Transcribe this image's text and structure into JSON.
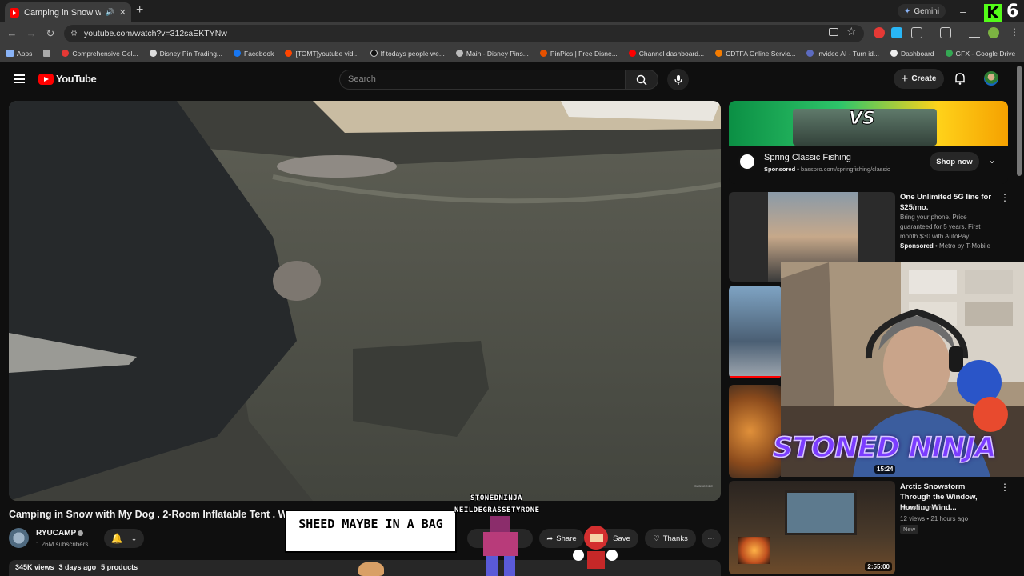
{
  "browser": {
    "tab_title": "Camping in Snow with My Do",
    "new_tab": "+",
    "gemini_label": "Gemini",
    "url": "youtube.com/watch?v=312saEKTYNw",
    "overlay_counter": "6",
    "bookmarks": [
      {
        "label": "Apps",
        "color": "#8ab4f8"
      },
      {
        "label": "Comprehensive Gol...",
        "color": "#e53935"
      },
      {
        "label": "Disney Pin Trading...",
        "color": "#dddddd"
      },
      {
        "label": "Facebook",
        "color": "#1877f2"
      },
      {
        "label": "[TOMT]youtube vid...",
        "color": "#ff4500"
      },
      {
        "label": "If todays people we...",
        "color": "#111111"
      },
      {
        "label": "Main - Disney Pins...",
        "color": "#bbbbbb"
      },
      {
        "label": "PinPics | Free Disne...",
        "color": "#e65100"
      },
      {
        "label": "Channel dashboard...",
        "color": "#ff0000"
      },
      {
        "label": "CDTFA Online Servic...",
        "color": "#f57c00"
      },
      {
        "label": "invideo AI - Turn id...",
        "color": "#5c6bc0"
      },
      {
        "label": "Dashboard",
        "color": "#eeeeee"
      },
      {
        "label": "GFX - Google Drive",
        "color": "#34a853"
      }
    ]
  },
  "youtube": {
    "logo_text": "YouTube",
    "search_placeholder": "Search",
    "create_label": "Create"
  },
  "video": {
    "title": "Camping in Snow with My Dog . 2-Room Inflatable Tent . W",
    "channel_name": "RYUCAMP",
    "subscribers": "1.26M subscribers",
    "share_label": "Share",
    "save_label": "Save",
    "thanks_label": "Thanks",
    "views": "345K views",
    "age": "3 days ago",
    "products": "5 products",
    "watermark": "SUBSCRIBE"
  },
  "sidebar": {
    "ad": {
      "title": "Spring Classic Fishing",
      "sponsored": "Sponsored",
      "domain": "basspro.com/springfishing/classic",
      "cta": "Shop now"
    },
    "ad2": {
      "title": "One Unlimited 5G line for $25/mo.",
      "body": "Bring your phone. Price guaranteed for 5 years. First month $30 with AutoPay.",
      "sponsored": "Sponsored",
      "advertiser": "Metro by T-Mobile"
    },
    "video3_duration": "15:24",
    "video4": {
      "title": "Arctic Snowstorm Through the Window, Howling Wind...",
      "channel": "Winter Murmur",
      "meta": "12 views • 21 hours ago",
      "badge": "New",
      "duration": "2:55:00"
    }
  },
  "overlay": {
    "streamer_name": "STONED NINJA",
    "caption": "SHEED MAYBE IN A BAG",
    "chat_user": "STONEDNINJA",
    "chat_msg": "NEILDEGRASSETYRONE"
  },
  "colors": {
    "youtube_red": "#ff0000",
    "ninja_purple": "#7b3cff",
    "kick_green": "#53fc18"
  }
}
